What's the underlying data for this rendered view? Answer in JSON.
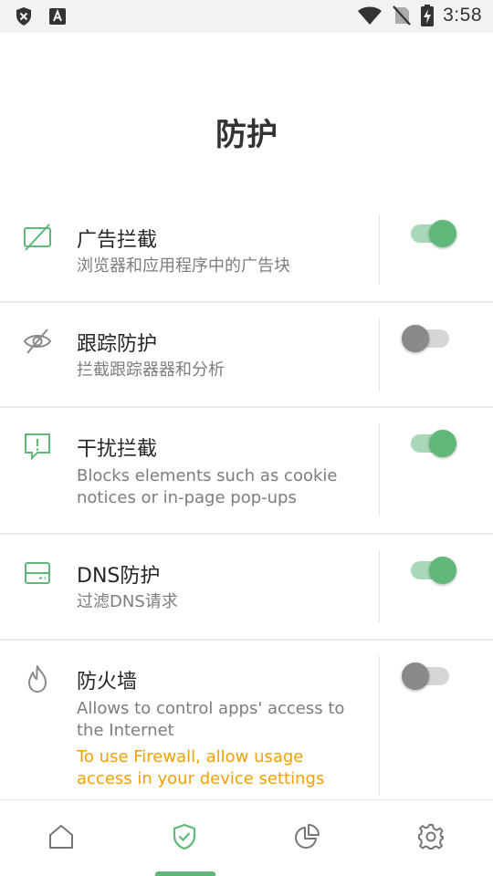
{
  "status_bar": {
    "time": "3:58",
    "left_icons": [
      "shield-x-icon",
      "font-a-icon"
    ],
    "right_icons": [
      "wifi-icon",
      "no-sim-icon",
      "battery-charging-icon"
    ]
  },
  "page": {
    "title": "防护"
  },
  "colors": {
    "accent": "#5fb879",
    "warning": "#f4a100",
    "text_secondary": "#7d7d7d"
  },
  "rows": [
    {
      "icon": "ad-block-icon",
      "title": "广告拦截",
      "subtitle": "浏览器和应用程序中的广告块",
      "enabled": true
    },
    {
      "icon": "eye-off-icon",
      "title": "跟踪防护",
      "subtitle": "拦截跟踪器器和分析",
      "enabled": false
    },
    {
      "icon": "alert-message-icon",
      "title": "干扰拦截",
      "subtitle": "Blocks elements such as cookie notices or in-page pop-ups",
      "enabled": true
    },
    {
      "icon": "dns-server-icon",
      "title": "DNS防护",
      "subtitle": "过滤DNS请求",
      "enabled": true
    },
    {
      "icon": "flame-icon",
      "title": "防火墙",
      "subtitle": "Allows to control apps' access to the Internet",
      "warning": "To use Firewall, allow usage access in your device settings",
      "enabled": false
    }
  ],
  "bottom_nav": {
    "items": [
      "home-icon",
      "shield-check-icon",
      "pie-chart-icon",
      "gear-icon"
    ],
    "active": "shield-check-icon"
  }
}
